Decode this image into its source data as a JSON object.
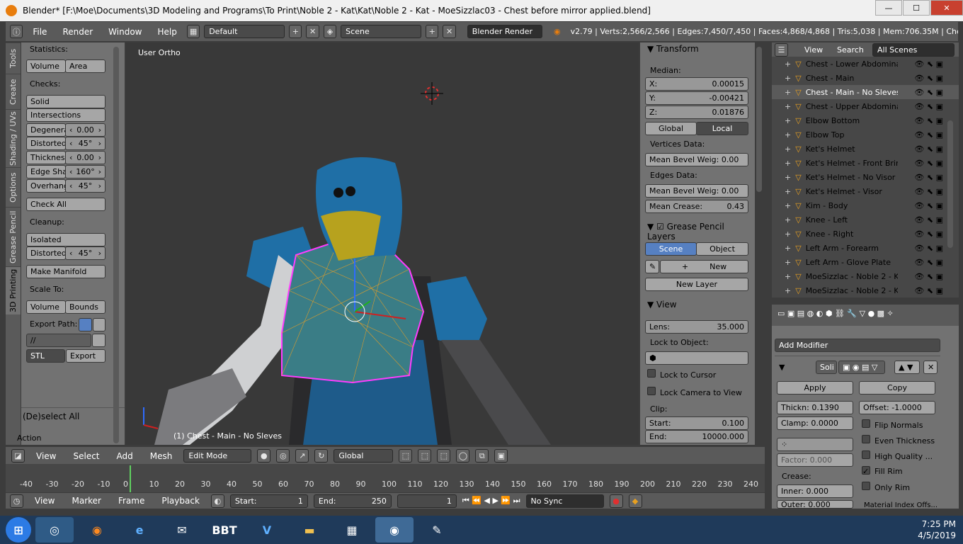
{
  "window": {
    "title": "Blender* [F:\\Moe\\Documents\\3D Modeling and Programs\\To Print\\Noble 2 - Kat\\Kat\\Noble 2 - Kat - MoeSizzlac03 - Chest before mirror applied.blend]",
    "min": "—",
    "max": "☐",
    "close": "✕"
  },
  "topbar": {
    "menus": [
      "File",
      "Render",
      "Window",
      "Help"
    ],
    "layout": "Default",
    "scene": "Scene",
    "engine": "Blender Render",
    "stats": "v2.79 | Verts:2,566/2,566 | Edges:7,450/7,450 | Faces:4,868/4,868 | Tris:5,038 | Mem:706.35M | Chest -"
  },
  "left_tabs": [
    "Tools",
    "Create",
    "Shading / UVs",
    "Options",
    "Grease Pencil",
    "3D Printing"
  ],
  "left_panel": {
    "statistics": "Statistics:",
    "volume": "Volume",
    "area": "Area",
    "checks": "Checks:",
    "solid": "Solid",
    "intersections": "Intersections",
    "degenerate": "Degenera",
    "degenerate_val": "0.00",
    "distorted": "Distorted",
    "distorted_val": "45°",
    "thickness": "Thicknes",
    "thickness_val": "0.00",
    "edge_sharp": "Edge Sha",
    "edge_sharp_val": "160°",
    "overhang": "Overhang",
    "overhang_val": "45°",
    "check_all": "Check All",
    "cleanup": "Cleanup:",
    "isolated": "Isolated",
    "distorted2": "Distorted",
    "distorted2_val": "45°",
    "make_manifold": "Make Manifold",
    "scale_to": "Scale To:",
    "volume2": "Volume",
    "bounds": "Bounds",
    "export_path": "Export Path:",
    "path_val": "//",
    "format": "STL",
    "export": "Export",
    "deselect_all": "(De)select All",
    "action": "Action"
  },
  "viewport": {
    "view_label": "User Ortho",
    "object_label": "(1) Chest - Main - No Sleves"
  },
  "transform": {
    "title": "Transform",
    "median": "Median:",
    "x": "X:",
    "x_val": "0.00015",
    "y": "Y:",
    "y_val": "-0.00421",
    "z": "Z:",
    "z_val": "0.01876",
    "global": "Global",
    "local": "Local",
    "vertices_data": "Vertices Data:",
    "mean_bevel_v": "Mean Bevel Weig: 0.00",
    "edges_data": "Edges Data:",
    "mean_bevel_e": "Mean Bevel Weig: 0.00",
    "mean_crease": "Mean Crease:",
    "mean_crease_val": "0.43"
  },
  "grease": {
    "title": "Grease Pencil Layers",
    "scene": "Scene",
    "object": "Object",
    "new": "New",
    "new_layer": "New Layer"
  },
  "view": {
    "title": "View",
    "lens": "Lens:",
    "lens_val": "35.000",
    "lock_object": "Lock to Object:",
    "lock_cursor": "Lock to Cursor",
    "lock_camera": "Lock Camera to View",
    "clip": "Clip:",
    "start": "Start:",
    "start_val": "0.100",
    "end": "End:",
    "end_val": "10000.000"
  },
  "outliner": {
    "view": "View",
    "search": "Search",
    "scenes": "All Scenes",
    "items": [
      "Chest - Lower Abdominal",
      "Chest - Main",
      "Chest - Main - No Sleves",
      "Chest - Upper Abdominal",
      "Elbow Bottom",
      "Elbow Top",
      "Ket's Helmet",
      "Ket's Helmet - Front Brim",
      "Ket's Helmet - No Visor",
      "Ket's Helmet - Visor",
      "Kim - Body",
      "Knee - Left",
      "Knee - Right",
      "Left Arm - Forearm",
      "Left Arm - Glove Plate",
      "MoeSizzlac - Noble 2 - Kat",
      "MoeSizzlac - Noble 2 - Kat"
    ]
  },
  "modifier": {
    "add": "Add Modifier",
    "name": "Soli",
    "apply": "Apply",
    "copy": "Copy",
    "thickness": "Thickn: 0.1390",
    "offset": "Offset:  -1.0000",
    "clamp": "Clamp:  0.0000",
    "flip_normals": "Flip Normals",
    "even_thickness": "Even Thickness",
    "high_quality": "High Quality ...",
    "factor": "Factor:  0.000",
    "fill_rim": "Fill Rim",
    "only_rim": "Only Rim",
    "crease": "Crease:",
    "inner": "Inner:   0.000",
    "outer": "Outer:   0.000",
    "material": "Material Index Offs..."
  },
  "view3d_header": {
    "view": "View",
    "select": "Select",
    "add": "Add",
    "mesh": "Mesh",
    "mode": "Edit Mode",
    "orientation": "Global"
  },
  "timeline": {
    "ticks": [
      "-40",
      "-30",
      "-20",
      "-10",
      "0",
      "10",
      "20",
      "30",
      "40",
      "50",
      "60",
      "70",
      "80",
      "90",
      "100",
      "110",
      "120",
      "130",
      "140",
      "150",
      "160",
      "170",
      "180",
      "190",
      "200",
      "210",
      "220",
      "230",
      "240"
    ]
  },
  "timeline_header": {
    "view": "View",
    "marker": "Marker",
    "frame": "Frame",
    "playback": "Playback",
    "start": "Start:",
    "start_val": "1",
    "end": "End:",
    "end_val": "250",
    "current": "1",
    "sync": "No Sync"
  },
  "taskbar": {
    "time": "7:25 PM",
    "date": "4/5/2019"
  }
}
